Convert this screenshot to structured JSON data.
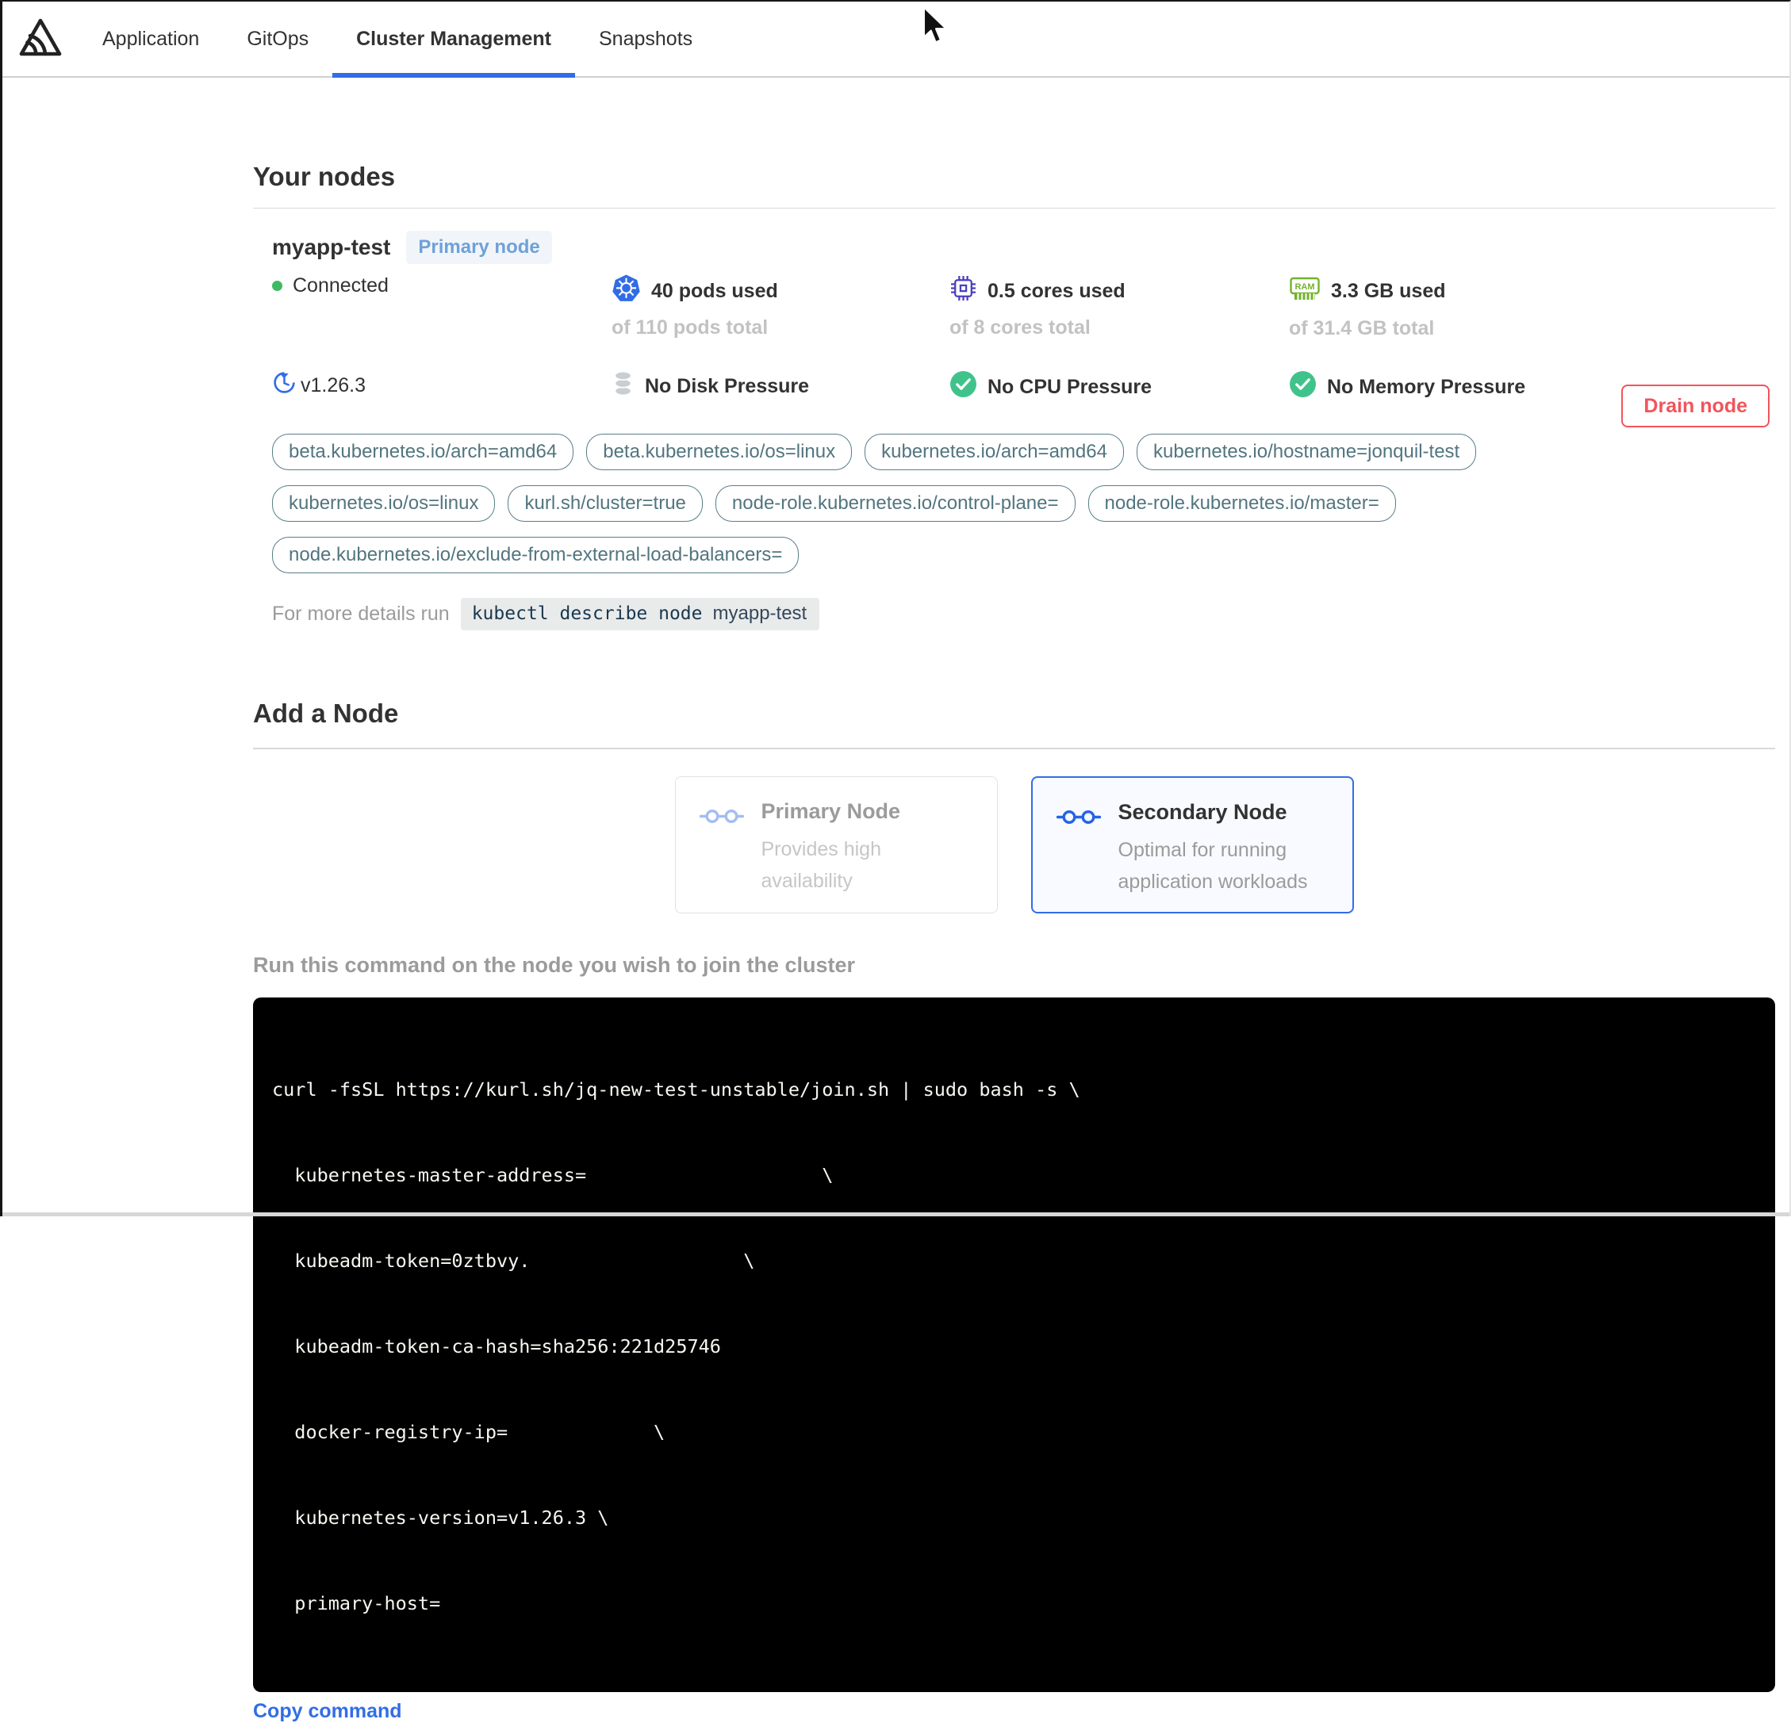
{
  "nav": {
    "logo_icon": "app-triangle-logo",
    "tabs": [
      {
        "label": "Application",
        "active": false
      },
      {
        "label": "GitOps",
        "active": false
      },
      {
        "label": "Cluster Management",
        "active": true
      },
      {
        "label": "Snapshots",
        "active": false
      }
    ]
  },
  "your_nodes": {
    "title": "Your nodes",
    "node": {
      "name": "myapp-test",
      "badge": "Primary node",
      "status": "Connected",
      "version": "v1.26.3",
      "stats": [
        {
          "icon": "kubernetes-icon",
          "label": "40 pods used",
          "sub": "of 110 pods total"
        },
        {
          "icon": "cpu-icon",
          "label": "0.5 cores used",
          "sub": "of 8 cores total"
        },
        {
          "icon": "ram-icon",
          "label": "3.3 GB used",
          "sub": "of 31.4 GB total"
        }
      ],
      "conditions": [
        {
          "icon": "disk-icon",
          "label": "No Disk Pressure"
        },
        {
          "icon": "check-circle-icon",
          "label": "No CPU Pressure"
        },
        {
          "icon": "check-circle-icon",
          "label": "No Memory Pressure"
        }
      ],
      "labels": [
        "beta.kubernetes.io/arch=amd64",
        "beta.kubernetes.io/os=linux",
        "kubernetes.io/arch=amd64",
        "kubernetes.io/hostname=jonquil-test",
        "kubernetes.io/os=linux",
        "kurl.sh/cluster=true",
        "node-role.kubernetes.io/control-plane=",
        "node-role.kubernetes.io/master=",
        "node.kubernetes.io/exclude-from-external-load-balancers="
      ],
      "details": {
        "prefix": "For more details run",
        "command": "kubectl describe node",
        "arg": "myapp-test"
      },
      "drain_button": "Drain node"
    }
  },
  "add_node": {
    "title": "Add a Node",
    "options": [
      {
        "title": "Primary Node",
        "subtitle": "Provides high availability",
        "selected": false
      },
      {
        "title": "Secondary Node",
        "subtitle": "Optimal for running application workloads",
        "selected": true
      }
    ],
    "instruction": "Run this command on the node you wish to join the cluster",
    "command_lines": [
      "curl -fsSL https://kurl.sh/jq-new-test-unstable/join.sh | sudo bash -s \\",
      "  kubernetes-master-address=                     \\",
      "  kubeadm-token=0ztbvy.                   \\",
      "  kubeadm-token-ca-hash=sha256:221d25746",
      "  docker-registry-ip=             \\",
      "  kubernetes-version=v1.26.3 \\",
      "  primary-host="
    ],
    "copy_link": "Copy command"
  },
  "colors": {
    "accent_blue": "#326de6",
    "danger_red": "#f2545b",
    "success_green": "#40c38b",
    "kubernetes_blue": "#326ce5",
    "cpu_purple": "#4a3ec0",
    "ram_green": "#73b32d",
    "label_teal": "#587e88",
    "badge_blue": "#6ea1d8"
  }
}
